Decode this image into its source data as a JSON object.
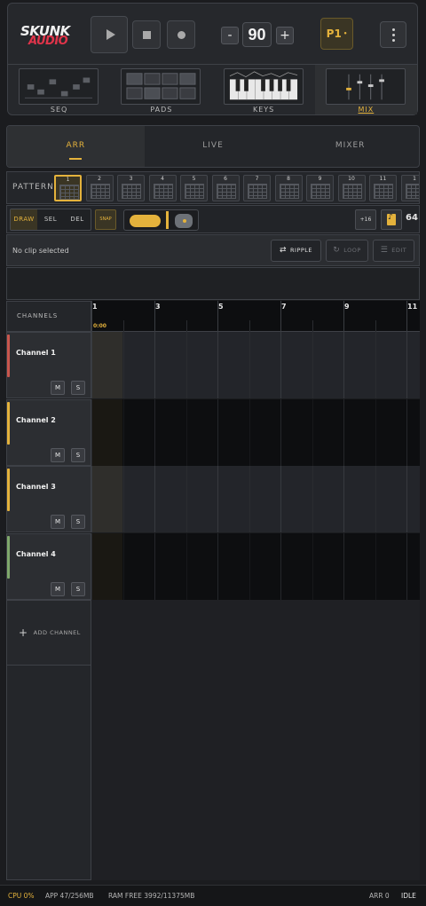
{
  "header": {
    "logo_line1": "SKUNK",
    "logo_line2": "AUDIO",
    "bpm": "90",
    "minus_label": "-",
    "plus_label": "+",
    "pattern_slot": "P1"
  },
  "modes": [
    {
      "label": "SEQ",
      "active": false
    },
    {
      "label": "PADS",
      "active": false
    },
    {
      "label": "KEYS",
      "active": false
    },
    {
      "label": "MIX",
      "active": true
    }
  ],
  "tabs": [
    {
      "label": "ARR",
      "active": true
    },
    {
      "label": "LIVE",
      "active": false
    },
    {
      "label": "MIXER",
      "active": false
    }
  ],
  "pattern_row": {
    "label": "PATTERN",
    "patterns": [
      "1",
      "2",
      "3",
      "4",
      "5",
      "6",
      "7",
      "8",
      "9",
      "10",
      "11",
      "1"
    ],
    "selected": "1"
  },
  "toolbar": {
    "tools": [
      "DRAW",
      "SEL",
      "DEL"
    ],
    "active_tool": "DRAW",
    "snap_label": "SNAP",
    "plus16_label": "+16",
    "steps": "64",
    "zoom_level": 0.5
  },
  "clip": {
    "status": "No clip selected",
    "ripple_label": "RIPPLE",
    "loop_label": "LOOP",
    "edit_label": "EDIT"
  },
  "timeline": {
    "channels_header": "CHANNELS",
    "bars": [
      "1",
      "3",
      "5",
      "7",
      "9",
      "11"
    ],
    "timecode": "0:00"
  },
  "channels": [
    {
      "name": "Channel 1",
      "color": "#c9564d",
      "mute": "M",
      "solo": "S"
    },
    {
      "name": "Channel 2",
      "color": "#e4b23c",
      "mute": "M",
      "solo": "S"
    },
    {
      "name": "Channel 3",
      "color": "#e4b23c",
      "mute": "M",
      "solo": "S"
    },
    {
      "name": "Channel 4",
      "color": "#7fa86b",
      "mute": "M",
      "solo": "S"
    }
  ],
  "add_channel_label": "ADD CHANNEL",
  "status": {
    "cpu": "CPU 0%",
    "app": "APP 47/256MB",
    "ram": "RAM FREE 3992/11375MB",
    "arr": "ARR 0",
    "state": "IDLE"
  },
  "colors": {
    "accent": "#e4b23c",
    "background": "#1b1c1f"
  }
}
